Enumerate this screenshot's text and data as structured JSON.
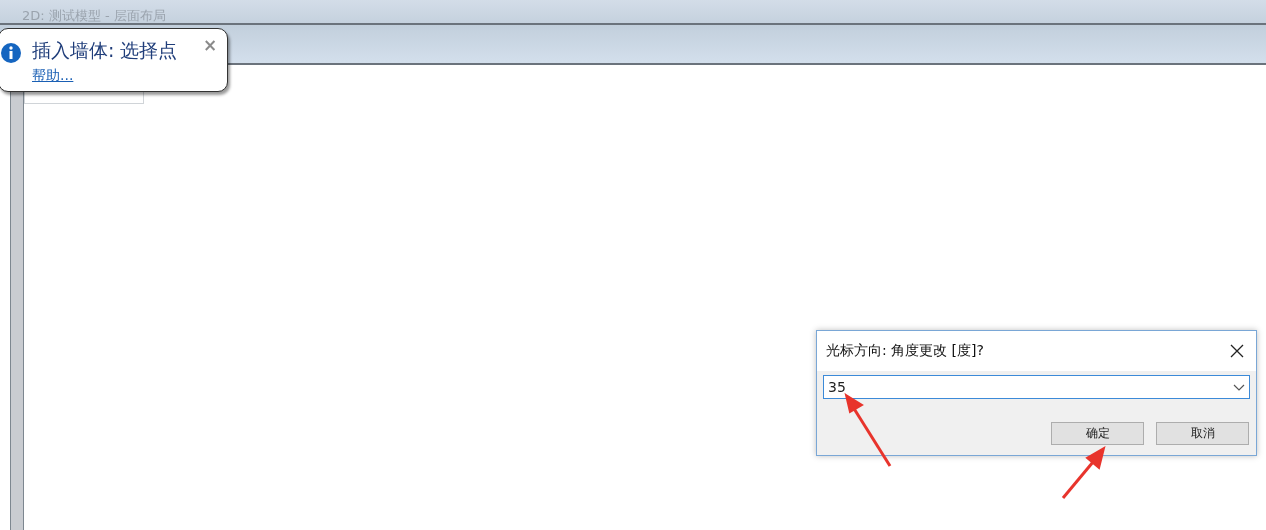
{
  "window": {
    "title": "2D: 测试模型 - 层面布局"
  },
  "tooltip": {
    "title": "插入墙体: 选择点",
    "link": "帮助...",
    "close": "×"
  },
  "dialog": {
    "title": "光标方向: 角度更改 [度]?",
    "value": "35",
    "buttons": [
      "确定",
      "取消"
    ]
  }
}
